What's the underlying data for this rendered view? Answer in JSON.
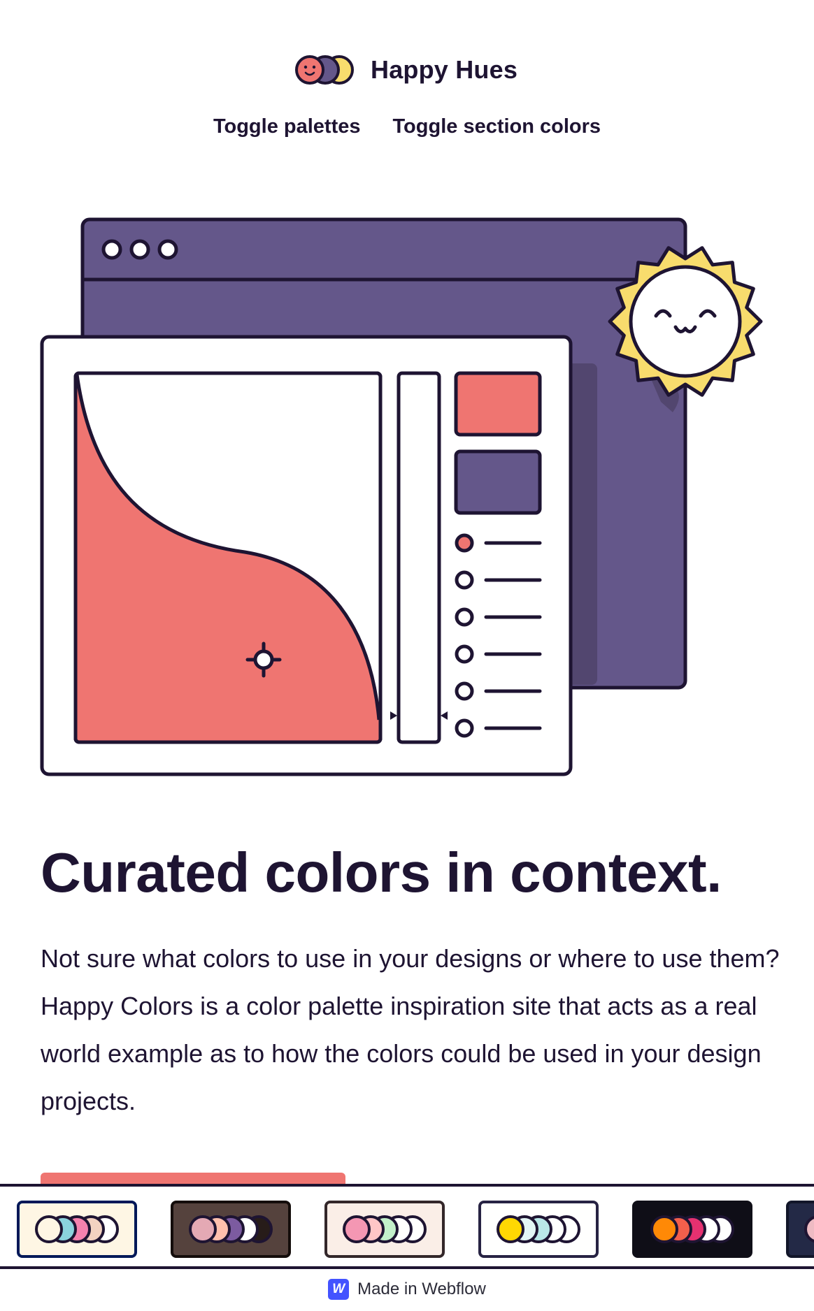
{
  "brand": {
    "name": "Happy Hues",
    "logo_icon": "three-smiling-circles-logo",
    "logo_colors": [
      "#ef7571",
      "#64578a",
      "#f8dc6d"
    ]
  },
  "nav": {
    "toggle_palettes": "Toggle palettes",
    "toggle_section_colors": "Toggle section colors"
  },
  "illustration": {
    "description_icon": "color-picker-app-window-icon",
    "sun_icon": "smiling-sun-icon",
    "colors": {
      "primary": "#ef7571",
      "secondary": "#64578a",
      "stroke": "#1e1432",
      "sun": "#f8dc6d",
      "background": "#ffffff"
    }
  },
  "hero": {
    "headline": "Curated colors in context.",
    "intro_part1": "Not sure what colors to use in your designs or where to use them?",
    "intro_part2": "Happy Colors is a color palette inspiration site that acts as a real world example as to how the colors could be used in your design projects."
  },
  "palettes": [
    {
      "background": "#fef6e4",
      "border": "#001858",
      "colors": [
        "#fef6e4",
        "#8bd3dd",
        "#f582ae",
        "#f3d2c1",
        "#ffffff"
      ]
    },
    {
      "background": "#55423d",
      "border": "#140d0b",
      "colors": [
        "#e4a9b4",
        "#ffc0ad",
        "#7c5ba0",
        "#fffffe",
        "#271c19"
      ]
    },
    {
      "background": "#faeee7",
      "border": "#33272a",
      "colors": [
        "#f497b3",
        "#ffc6c7",
        "#c3f0ca",
        "#fffffe",
        "#fffffe"
      ]
    },
    {
      "background": "#fffffe",
      "border": "#272343",
      "colors": [
        "#ffd803",
        "#e3f6f5",
        "#bae8e8",
        "#fffffe",
        "#fffffe"
      ]
    },
    {
      "background": "#0f0e17",
      "border": "#0f0e17",
      "colors": [
        "#ff8906",
        "#f25f4c",
        "#e53170",
        "#fffffe",
        "#fffffe"
      ]
    },
    {
      "background": "#232946",
      "border": "#121629",
      "colors": [
        "#eebbc3",
        "#b8c1ec",
        "#fffffe",
        "#fffffe",
        "#fffffe"
      ]
    }
  ],
  "footer": {
    "badge_letter": "W",
    "badge_icon": "webflow-logo-icon",
    "made_in": "Made in Webflow"
  }
}
